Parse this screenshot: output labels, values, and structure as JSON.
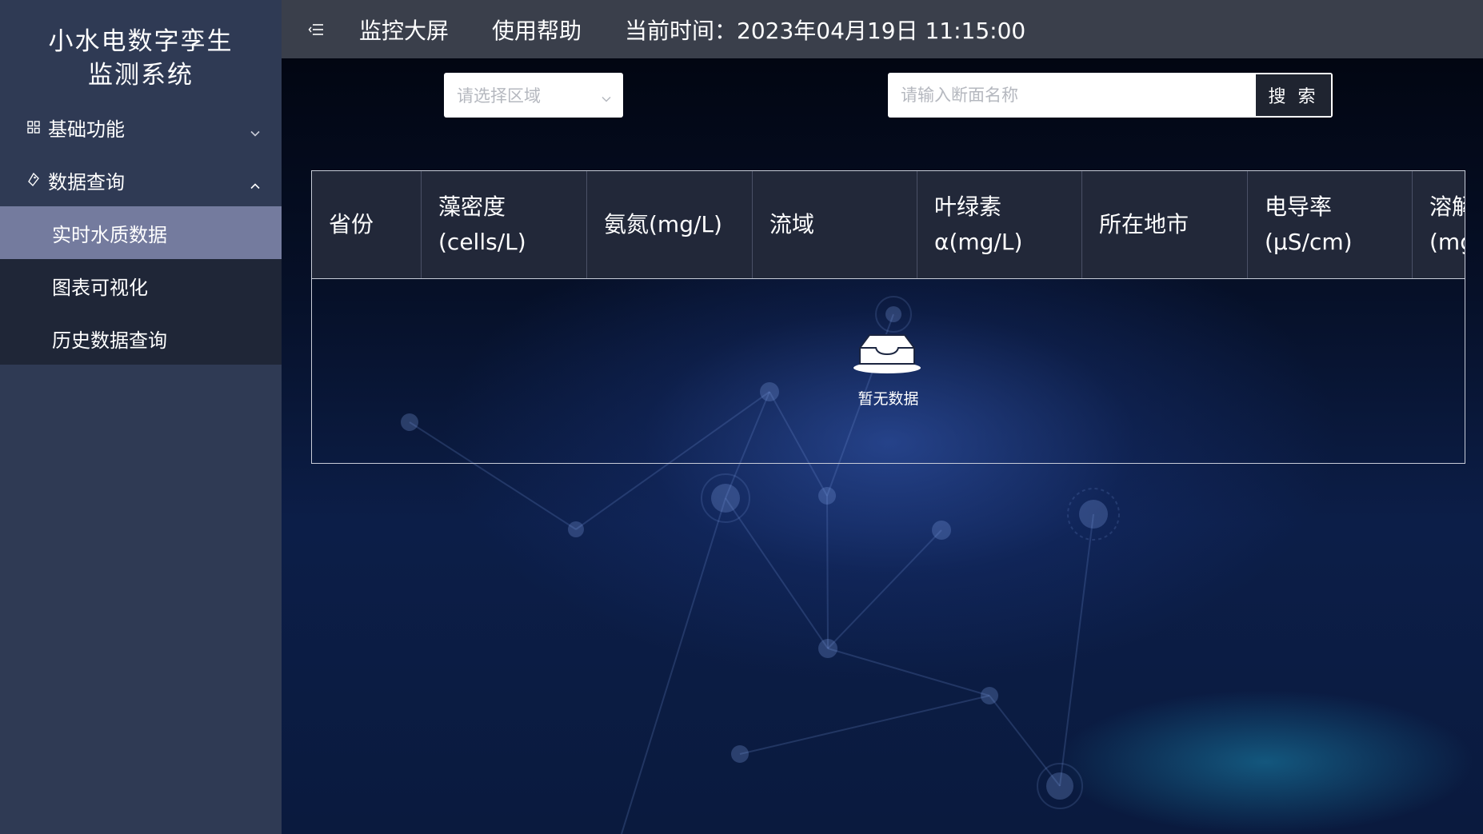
{
  "sidebar": {
    "title_line1": "小水电数字孪生",
    "title_line2": "监测系统",
    "groups": [
      {
        "label": "基础功能",
        "icon": "grid-icon",
        "expanded": false
      },
      {
        "label": "数据查询",
        "icon": "tag-icon",
        "expanded": true
      }
    ],
    "subitems": [
      {
        "label": "实时水质数据",
        "active": true
      },
      {
        "label": "图表可视化",
        "active": false
      },
      {
        "label": "历史数据查询",
        "active": false
      }
    ]
  },
  "topbar": {
    "nav": [
      "监控大屏",
      "使用帮助"
    ],
    "time_label": "当前时间：",
    "time_value": "2023年04月19日 11:15:00"
  },
  "filters": {
    "region_placeholder": "请选择区域",
    "search_placeholder": "请输入断面名称",
    "search_button": "搜 索"
  },
  "table": {
    "columns": [
      {
        "line1": "省份",
        "line2": ""
      },
      {
        "line1": "藻密度",
        "line2": "(cells/L)"
      },
      {
        "line1": "氨氮(mg/L)",
        "line2": ""
      },
      {
        "line1": "流域",
        "line2": ""
      },
      {
        "line1": "叶绿素",
        "line2": "α(mg/L)"
      },
      {
        "line1": "所在地市",
        "line2": ""
      },
      {
        "line1": "电导率",
        "line2": "(μS/cm)"
      },
      {
        "line1": "溶解",
        "line2": "(mg"
      }
    ],
    "empty_text": "暂无数据"
  },
  "colors": {
    "sidebar_bg": "#2f3a54",
    "submenu_bg": "#1f2637",
    "active_item_bg": "#747b9e",
    "topbar_bg": "#3a3f4b",
    "table_header_bg": "#222839"
  }
}
